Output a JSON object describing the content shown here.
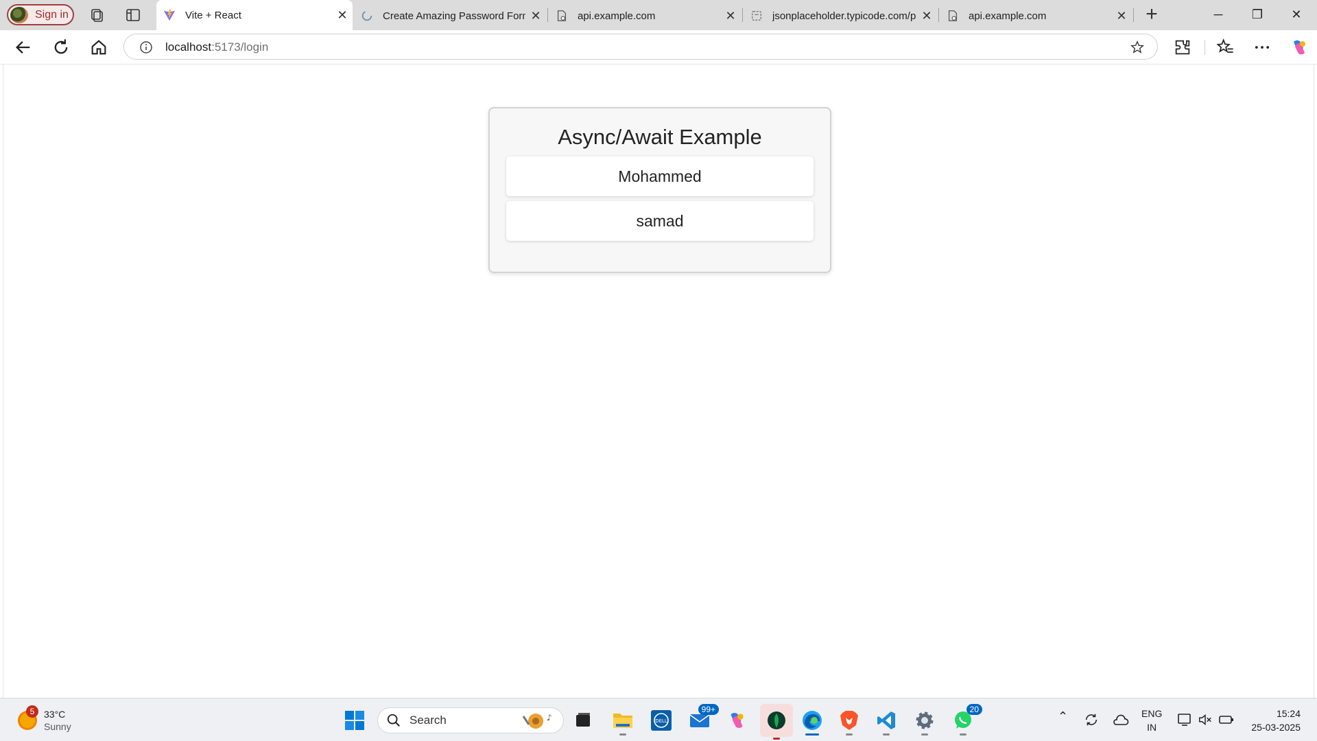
{
  "browser": {
    "signin_label": "Sign in",
    "tabs": [
      {
        "title": "Vite + React",
        "active": true
      },
      {
        "title": "Create Amazing Password Form",
        "active": false
      },
      {
        "title": "api.example.com",
        "active": false
      },
      {
        "title": "jsonplaceholder.typicode.com/p",
        "active": false
      },
      {
        "title": "api.example.com",
        "active": false
      }
    ],
    "close_glyph": "✕",
    "url_host": "localhost",
    "url_path": ":5173/login"
  },
  "page": {
    "title": "Async/Await Example",
    "items": [
      "Mohammed",
      "samad"
    ]
  },
  "taskbar": {
    "weather_temp": "33°C",
    "weather_cond": "Sunny",
    "weather_badge": "5",
    "search_label": "Search",
    "mail_badge": "99+",
    "whatsapp_badge": "20",
    "lang_top": "ENG",
    "lang_bottom": "IN",
    "time": "15:24",
    "date": "25-03-2025"
  },
  "colors": {
    "accent": "#0067c0",
    "signin": "#a52a2a"
  }
}
